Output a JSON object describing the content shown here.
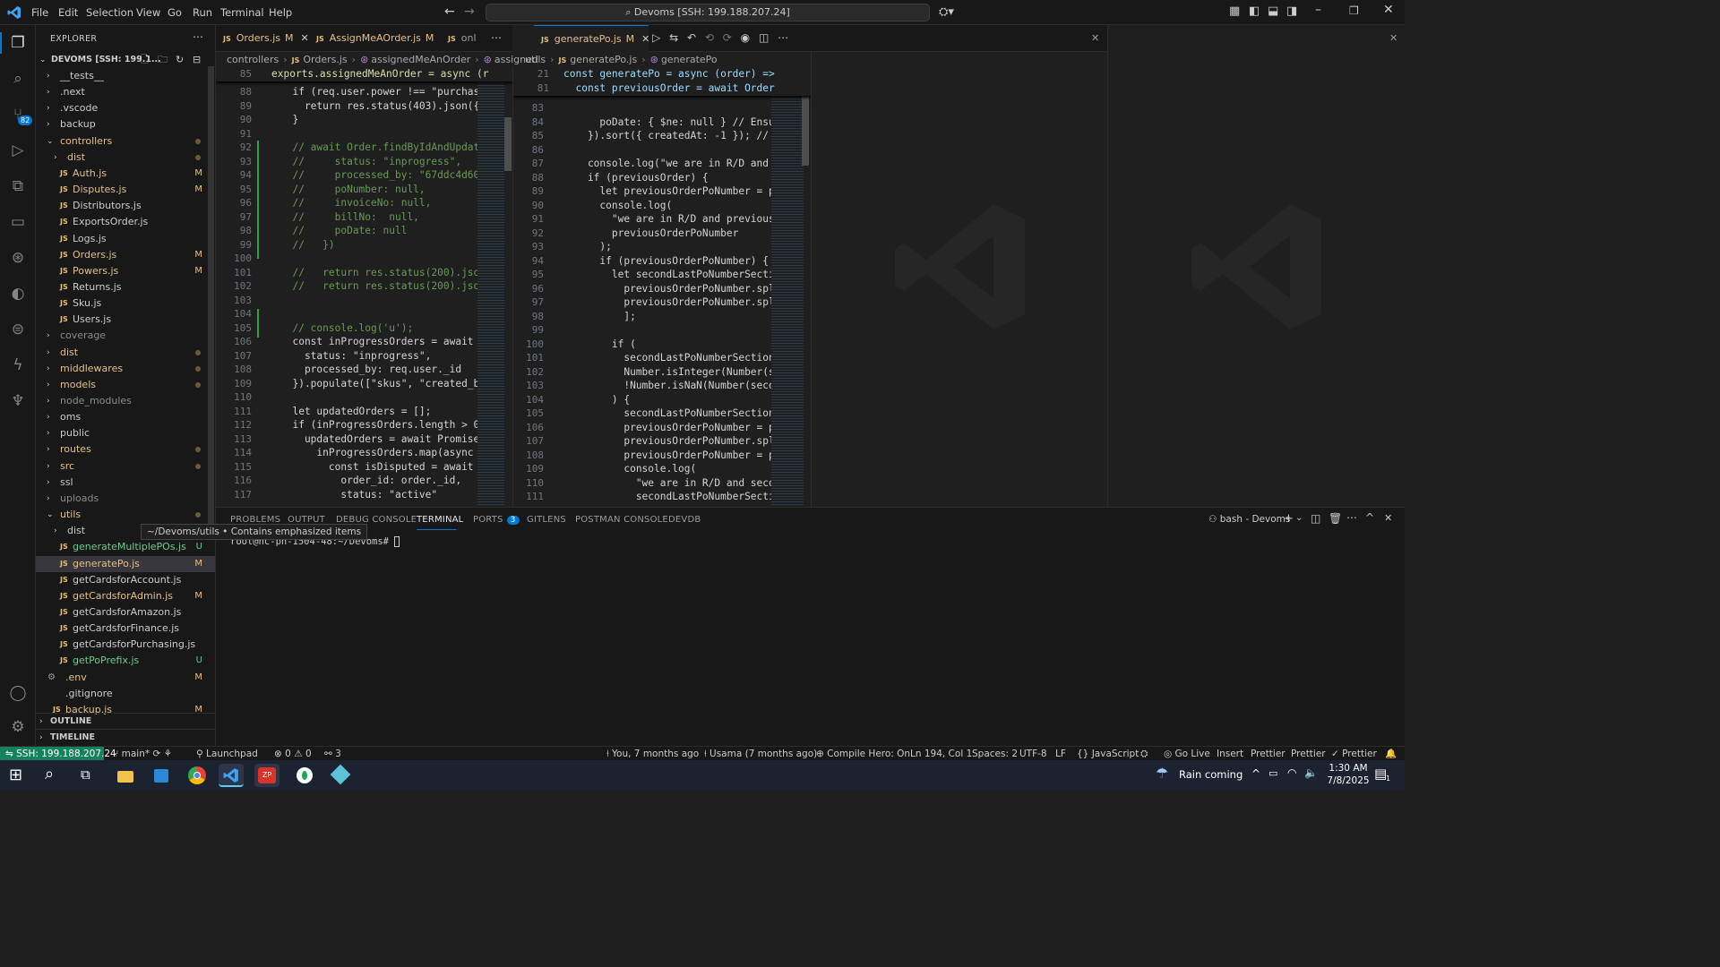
{
  "titlebar": {
    "menu": [
      "File",
      "Edit",
      "Selection",
      "View",
      "Go",
      "Run",
      "Terminal",
      "Help"
    ],
    "search": "Devoms [SSH: 199.188.207.24]"
  },
  "sidebar": {
    "title": "EXPLORER",
    "root": "DEVOMS [SSH: 199.1...",
    "items": [
      {
        "label": "__tests__",
        "kind": "folder",
        "depth": 1,
        "open": false,
        "status": ""
      },
      {
        "label": ".next",
        "kind": "folder",
        "depth": 1,
        "open": false,
        "status": ""
      },
      {
        "label": ".vscode",
        "kind": "folder",
        "depth": 1,
        "open": false,
        "status": ""
      },
      {
        "label": "backup",
        "kind": "folder",
        "depth": 1,
        "open": false,
        "status": ""
      },
      {
        "label": "controllers",
        "kind": "folder",
        "depth": 1,
        "open": true,
        "status": "dot"
      },
      {
        "label": "dist",
        "kind": "folder",
        "depth": 2,
        "open": false,
        "status": "dot"
      },
      {
        "label": "Auth.js",
        "kind": "js",
        "depth": 2,
        "status": "M"
      },
      {
        "label": "Disputes.js",
        "kind": "js",
        "depth": 2,
        "status": "M"
      },
      {
        "label": "Distributors.js",
        "kind": "js",
        "depth": 2,
        "status": ""
      },
      {
        "label": "ExportsOrder.js",
        "kind": "js",
        "depth": 2,
        "status": ""
      },
      {
        "label": "Logs.js",
        "kind": "js",
        "depth": 2,
        "status": ""
      },
      {
        "label": "Orders.js",
        "kind": "js",
        "depth": 2,
        "status": "M"
      },
      {
        "label": "Powers.js",
        "kind": "js",
        "depth": 2,
        "status": "M"
      },
      {
        "label": "Returns.js",
        "kind": "js",
        "depth": 2,
        "status": ""
      },
      {
        "label": "Sku.js",
        "kind": "js",
        "depth": 2,
        "status": ""
      },
      {
        "label": "Users.js",
        "kind": "js",
        "depth": 2,
        "status": ""
      },
      {
        "label": "coverage",
        "kind": "folder",
        "depth": 1,
        "open": false,
        "status": ""
      },
      {
        "label": "dist",
        "kind": "folder",
        "depth": 1,
        "open": false,
        "status": "dot"
      },
      {
        "label": "middlewares",
        "kind": "folder",
        "depth": 1,
        "open": false,
        "status": "dot"
      },
      {
        "label": "models",
        "kind": "folder",
        "depth": 1,
        "open": false,
        "status": "dot"
      },
      {
        "label": "node_modules",
        "kind": "folder",
        "depth": 1,
        "open": false,
        "status": ""
      },
      {
        "label": "oms",
        "kind": "folder",
        "depth": 1,
        "open": false,
        "status": ""
      },
      {
        "label": "public",
        "kind": "folder",
        "depth": 1,
        "open": false,
        "status": ""
      },
      {
        "label": "routes",
        "kind": "folder",
        "depth": 1,
        "open": false,
        "status": "dot"
      },
      {
        "label": "src",
        "kind": "folder",
        "depth": 1,
        "open": false,
        "status": "dot"
      },
      {
        "label": "ssl",
        "kind": "folder",
        "depth": 1,
        "open": false,
        "status": ""
      },
      {
        "label": "uploads",
        "kind": "folder",
        "depth": 1,
        "open": false,
        "status": ""
      },
      {
        "label": "utils",
        "kind": "folder",
        "depth": 1,
        "open": true,
        "status": "dot"
      },
      {
        "label": "dist",
        "kind": "folder",
        "depth": 2,
        "open": false,
        "status": ""
      },
      {
        "label": "generateMultiplePOs.js",
        "kind": "js",
        "depth": 2,
        "status": "U"
      },
      {
        "label": "generatePo.js",
        "kind": "js",
        "depth": 2,
        "status": "M",
        "selected": true
      },
      {
        "label": "getCardsforAccount.js",
        "kind": "js",
        "depth": 2,
        "status": ""
      },
      {
        "label": "getCardsforAdmin.js",
        "kind": "js",
        "depth": 2,
        "status": "M"
      },
      {
        "label": "getCardsforAmazon.js",
        "kind": "js",
        "depth": 2,
        "status": ""
      },
      {
        "label": "getCardsforFinance.js",
        "kind": "js",
        "depth": 2,
        "status": ""
      },
      {
        "label": "getCardsforPurchasing.js",
        "kind": "js",
        "depth": 2,
        "status": ""
      },
      {
        "label": "getPoPrefix.js",
        "kind": "js",
        "depth": 2,
        "status": "U"
      },
      {
        "label": ".env",
        "kind": "gear",
        "depth": 1,
        "status": "M"
      },
      {
        "label": ".gitignore",
        "kind": "plain",
        "depth": 1,
        "status": ""
      },
      {
        "label": "backup.js",
        "kind": "js",
        "depth": 1,
        "status": "M"
      }
    ],
    "tooltip": "~/Devoms/utils • Contains emphasized items",
    "outline": "OUTLINE",
    "timeline": "TIMELINE"
  },
  "tabs_left": [
    {
      "label": "Orders.js",
      "status": "M",
      "active": false
    },
    {
      "label": "AssignMeAOrder.js",
      "status": "M",
      "active": false
    },
    {
      "label": "onl",
      "status": "",
      "active": false
    }
  ],
  "tabs_right": [
    {
      "label": "generatePo.js",
      "status": "M",
      "active": true
    }
  ],
  "breadcrumb_left": [
    "controllers",
    "Orders.js",
    "assignedMeAnOrder",
    "assigned"
  ],
  "breadcrumb_right": [
    "utils",
    "generatePo.js",
    "generatePo"
  ],
  "editor_left": {
    "sticky": {
      "line": "85",
      "text": "exports.assignedMeAnOrder = async (r"
    },
    "lines": [
      {
        "n": "88",
        "t": "  if (req.user.power !== \"purchas"
      },
      {
        "n": "89",
        "t": "    return res.status(403).json({ "
      },
      {
        "n": "90",
        "t": "  }"
      },
      {
        "n": "91",
        "t": ""
      },
      {
        "n": "92",
        "t": "  // await Order.findByIdAndUpdate"
      },
      {
        "n": "93",
        "t": "  //     status: \"inprogress\","
      },
      {
        "n": "94",
        "t": "  //     processed_by: \"67ddc4d60"
      },
      {
        "n": "95",
        "t": "  //     poNumber: null,"
      },
      {
        "n": "96",
        "t": "  //     invoiceNo: null,"
      },
      {
        "n": "97",
        "t": "  //     billNo:  null,"
      },
      {
        "n": "98",
        "t": "  //     poDate: null"
      },
      {
        "n": "99",
        "t": "  //   })"
      },
      {
        "n": "100",
        "t": ""
      },
      {
        "n": "101",
        "t": "  //   return res.status(200).json"
      },
      {
        "n": "102",
        "t": "  //   return res.status(200).json"
      },
      {
        "n": "103",
        "t": ""
      },
      {
        "n": "104",
        "t": ""
      },
      {
        "n": "105",
        "t": "  // console.log('u');"
      },
      {
        "n": "106",
        "t": "  const inProgressOrders = await O"
      },
      {
        "n": "107",
        "t": "    status: \"inprogress\","
      },
      {
        "n": "108",
        "t": "    processed_by: req.user._id"
      },
      {
        "n": "109",
        "t": "  }).populate([\"skus\", \"created_b"
      },
      {
        "n": "110",
        "t": ""
      },
      {
        "n": "111",
        "t": "  let updatedOrders = [];"
      },
      {
        "n": "112",
        "t": "  if (inProgressOrders.length > 0"
      },
      {
        "n": "113",
        "t": "    updatedOrders = await Promise"
      },
      {
        "n": "114",
        "t": "      inProgressOrders.map(async "
      },
      {
        "n": "115",
        "t": "        const isDisputed = await D"
      },
      {
        "n": "116",
        "t": "          order_id: order._id,"
      },
      {
        "n": "117",
        "t": "          status: \"active\""
      }
    ]
  },
  "editor_right": {
    "sticky": [
      {
        "line": "21",
        "text": "const generatePo = async (order) =>"
      },
      {
        "line": "81",
        "text": "  const previousOrder = await Order"
      }
    ],
    "lines": [
      {
        "n": "83",
        "t": ""
      },
      {
        "n": "84",
        "t": "      poDate: { $ne: null } // Ensur"
      },
      {
        "n": "85",
        "t": "    }).sort({ createdAt: -1 }); // L"
      },
      {
        "n": "86",
        "t": ""
      },
      {
        "n": "87",
        "t": "    console.log(\"we are in R/D and p"
      },
      {
        "n": "88",
        "t": "    if (previousOrder) {"
      },
      {
        "n": "89",
        "t": "      let previousOrderPoNumber = pr"
      },
      {
        "n": "90",
        "t": "      console.log("
      },
      {
        "n": "91",
        "t": "        \"we are in R/D and previous"
      },
      {
        "n": "92",
        "t": "        previousOrderPoNumber"
      },
      {
        "n": "93",
        "t": "      );"
      },
      {
        "n": "94",
        "t": "      if (previousOrderPoNumber) {"
      },
      {
        "n": "95",
        "t": "        let secondLastPoNumberSectic"
      },
      {
        "n": "96",
        "t": "          previousOrderPoNumber.spli"
      },
      {
        "n": "97",
        "t": "          previousOrderPoNumber.spli"
      },
      {
        "n": "98",
        "t": "          ];"
      },
      {
        "n": "99",
        "t": ""
      },
      {
        "n": "100",
        "t": "        if ("
      },
      {
        "n": "101",
        "t": "          secondLastPoNumberSection."
      },
      {
        "n": "102",
        "t": "          Number.isInteger(Number(se"
      },
      {
        "n": "103",
        "t": "          !Number.isNaN(Number(secon"
      },
      {
        "n": "104",
        "t": "        ) {"
      },
      {
        "n": "105",
        "t": "          secondLastPoNumberSection "
      },
      {
        "n": "106",
        "t": "          previousOrderPoNumber = pr"
      },
      {
        "n": "107",
        "t": "          previousOrderPoNumber.spli"
      },
      {
        "n": "108",
        "t": "          previousOrderPoNumber = pr"
      },
      {
        "n": "109",
        "t": "          console.log("
      },
      {
        "n": "110",
        "t": "            \"we are in R/D and secon"
      },
      {
        "n": "111",
        "t": "            secondLastPoNumberSectic"
      }
    ]
  },
  "panel": {
    "tabs": [
      "PROBLEMS",
      "OUTPUT",
      "DEBUG CONSOLE",
      "TERMINAL",
      "PORTS",
      "GITLENS",
      "POSTMAN CONSOLE",
      "DEVDB"
    ],
    "active_tab": "TERMINAL",
    "ports_count": "3",
    "terminal_name": "bash - Devoms",
    "prompt": "root@hc-ph-1504-48:~/Devoms# "
  },
  "statusbar": {
    "remote": "SSH: 199.188.207.24",
    "branch": "main*",
    "launchpad": "Launchpad",
    "errors": "0",
    "warnings": "0",
    "ports": "3",
    "blame": "You, 7 months ago",
    "author": "Usama (7 months ago)",
    "compile_hero": "Compile Hero: On",
    "position": "Ln 194, Col 1",
    "spaces": "Spaces: 2",
    "encoding": "UTF-8",
    "eol": "LF",
    "language": "JavaScript",
    "golive": "Go Live",
    "insert": "Insert",
    "prettier1": "Prettier",
    "prettier2": "Prettier",
    "prettier3": "Prettier"
  },
  "activity_badges": {
    "scm": "82"
  },
  "taskbar": {
    "weather": "Rain coming",
    "time": "1:30 AM",
    "date": "7/8/2025",
    "notif": "1"
  },
  "colors": {
    "accent": "#0078d4",
    "remote": "#16825d",
    "modified": "#e2c08d",
    "untracked": "#73c991"
  }
}
